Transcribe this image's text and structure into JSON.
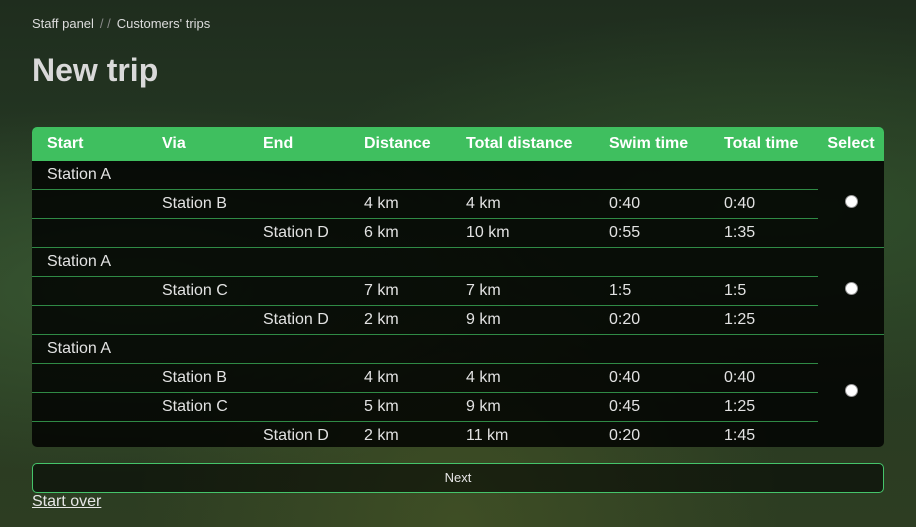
{
  "breadcrumb": {
    "items": [
      "Staff panel",
      "Customers' trips"
    ],
    "separator": "/ /"
  },
  "page_title": "New trip",
  "table": {
    "headers": [
      "Start",
      "Via",
      "End",
      "Distance",
      "Total distance",
      "Swim time",
      "Total time",
      "Select"
    ],
    "trips": [
      {
        "rows": [
          [
            "Station A",
            "",
            "",
            "",
            "",
            "",
            ""
          ],
          [
            "",
            "Station B",
            "",
            "4 km",
            "4 km",
            "0:40",
            "0:40"
          ],
          [
            "",
            "",
            "Station D",
            "6 km",
            "10 km",
            "0:55",
            "1:35"
          ]
        ]
      },
      {
        "rows": [
          [
            "Station A",
            "",
            "",
            "",
            "",
            "",
            ""
          ],
          [
            "",
            "Station C",
            "",
            "7 km",
            "7 km",
            "1:5",
            "1:5"
          ],
          [
            "",
            "",
            "Station D",
            "2 km",
            "9 km",
            "0:20",
            "1:25"
          ]
        ]
      },
      {
        "rows": [
          [
            "Station A",
            "",
            "",
            "",
            "",
            "",
            ""
          ],
          [
            "",
            "Station B",
            "",
            "4 km",
            "4 km",
            "0:40",
            "0:40"
          ],
          [
            "",
            "Station C",
            "",
            "5 km",
            "9 km",
            "0:45",
            "1:25"
          ],
          [
            "",
            "",
            "Station D",
            "2 km",
            "11 km",
            "0:20",
            "1:45"
          ]
        ]
      }
    ]
  },
  "buttons": {
    "next_label": "Next"
  },
  "links": {
    "start_over": "Start over"
  },
  "colors": {
    "header_green": "#3fbf5f",
    "border_green": "#2f8a45"
  }
}
